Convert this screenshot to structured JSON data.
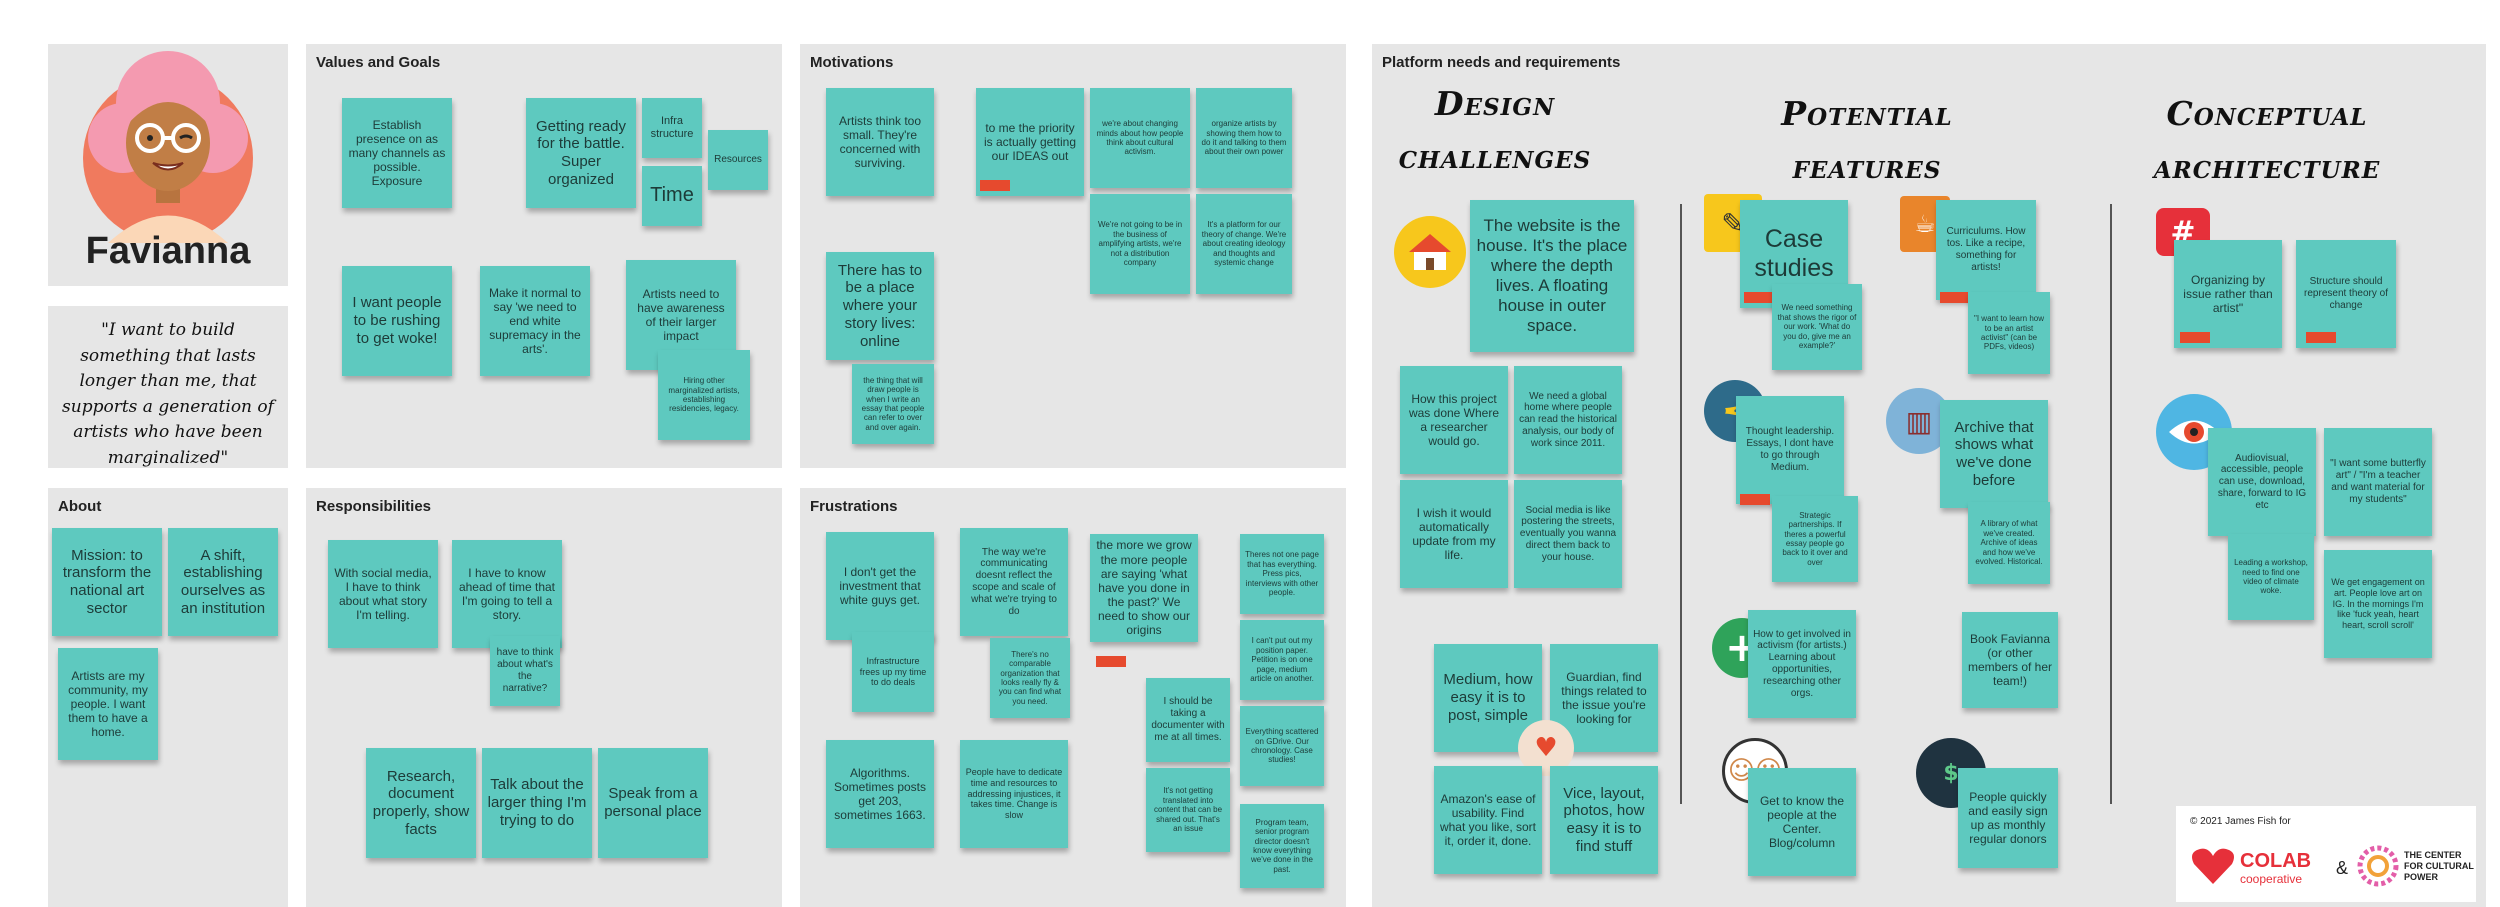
{
  "persona": {
    "name": "Favianna",
    "quote": "\"I want to build something that lasts longer than me, that supports a generation of  artists who have been marginalized\""
  },
  "about": {
    "title": "About",
    "notes": [
      "Mission: to transform the national art sector",
      "A shift, establishing ourselves as an institution",
      "Artists are my community, my people. I want them to have a home."
    ]
  },
  "values": {
    "title": "Values and Goals",
    "notes": [
      "Establish presence on as many channels as possible. Exposure",
      "Getting ready for the battle. Super organized",
      "Infra structure",
      "Resources",
      "Time",
      "I want people to be rushing to get woke!",
      "Make it normal to say 'we need to end white supremacy in the arts'.",
      "Artists need to have awareness of their larger impact",
      "Hiring other marginalized artists, establishing residencies, legacy."
    ]
  },
  "responsibilities": {
    "title": "Responsibilities",
    "notes": [
      "With social media, I have to think about what story I'm telling.",
      "I have to know ahead of time that I'm going to tell a story.",
      "have to think about what's the narrative?",
      "Research, document properly, show facts",
      "Talk about the larger thing I'm trying to do",
      "Speak from a personal place"
    ]
  },
  "motivations": {
    "title": "Motivations",
    "notes": [
      "Artists think too small. They're concerned with surviving.",
      "to me the priority is actually getting our IDEAS out",
      "we're about changing minds about how people think about cultural activism.",
      "organize artists by showing them how to do it and talking to them about their own power",
      "We're not going to be in the business of amplifying artists, we're not a distribution company",
      "It's a platform for our theory of change. We're about creating ideology and thoughts and systemic change",
      "There has to be a place where your story lives: online",
      "the thing that will draw people is when I write an essay that people can refer to over and over again."
    ]
  },
  "frustrations": {
    "title": "Frustrations",
    "notes": [
      "I don't get the investment that white guys get.",
      "Infrastructure frees up my time to do deals",
      "Algorithms. Sometimes posts get 203, sometimes 1663.",
      "The way we're communicating doesnt reflect the scope and scale of what we're trying to do",
      "There's no comparable organization that looks really fly & you can find what you need.",
      "People have to dedicate time and resources to addressing injustices, it takes time. Change is slow",
      "the more we grow the more people are saying 'what have you done in the past?' We need to show our origins",
      "Theres not one page that has everything. Press pics, interviews with other people.",
      "I can't put out my position paper. Petition is on one page, medium article on another.",
      "I should be taking a documenter with me at all times.",
      "Everything scattered on GDrive. Our chronology. Case studies!",
      "It's not getting translated into content that can be shared out. That's an issue",
      "Program team, senior program director doesn't know everything we've done in the past."
    ]
  },
  "platform": {
    "title": "Platform needs and requirements",
    "headings": [
      "Design challenges",
      "Potential features",
      "Conceptual architecture"
    ],
    "design_notes": [
      "The website is the house. It's the place where the depth lives.  A floating house in outer space.",
      "How this project was done Where a researcher would go.",
      "We need a global home where people can read the historical analysis, our body of work since 2011.",
      "I wish it would automatically update from my life.",
      "Social media is like postering the streets, eventually you wanna direct them back to your house.",
      "Medium, how easy it is to post, simple",
      "Guardian, find things related to the issue you're looking for",
      "Amazon's ease of usability. Find what you like, sort it, order it, done.",
      "Vice, layout, photos, how easy it is to find stuff"
    ],
    "feature_notes": [
      "Case studies",
      "We need something that shows the rigor of our work. 'What do you do, give me an example?'",
      "Curriculums. How tos. Like a recipe, something for artists!",
      "\"I want to learn how to be an artist activist\" (can be PDFs, videos)",
      "Thought leadership. Essays, I dont have to go through Medium.",
      "Strategic partnerships. If theres a powerful essay people go back to it over and over",
      "Archive that shows what we've done before",
      "A library of what we've created. Archive of ideas and how we've evolved. Historical.",
      "How to get involved in activism (for artists.) Learning about opportunities, researching other orgs.",
      "Book Favianna (or other members of her team!)",
      "Get to know the people  at the Center. Blog/column",
      "People quickly and easily sign up as monthly regular donors"
    ],
    "arch_notes": [
      "Organizing by issue rather than artist\"",
      "Structure should represent theory of change",
      "Audiovisual, accessible, people can use, download, share, forward to IG etc",
      "\"I want some butterfly art\" / \"I'm a teacher and want  material for my students\"",
      "Leading a workshop, need to find one video of climate woke.",
      "We get engagement on art. People love art on IG. In the mornings I'm like 'fuck yeah, heart heart, scroll scroll'"
    ]
  },
  "credits": {
    "copyright": "© 2021 James Fish for",
    "colab": "COLAB",
    "colab_sub": "cooperative",
    "amp": "&",
    "ccp": "THE CENTER FOR CULTURAL POWER"
  },
  "colors": {
    "note": "#5ec9bf",
    "panel": "#e6e6e6",
    "tag": "#e64a2e"
  }
}
